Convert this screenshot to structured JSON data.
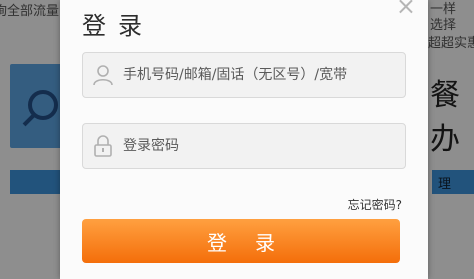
{
  "background": {
    "top_left_fragment": "询全部流量",
    "right_line1": "一样",
    "right_line2": "选择",
    "right_line3": "超超实惠",
    "big_text": "餐办",
    "bar_right_text": "理"
  },
  "modal": {
    "title": "登录",
    "close_label": "×",
    "account": {
      "placeholder": "手机号码/邮箱/固话（无区号）/宽带",
      "value": ""
    },
    "password": {
      "placeholder": "登录密码",
      "value": ""
    },
    "forgot_label": "忘记密码?",
    "login_button_label": "登录"
  },
  "colors": {
    "accent": "#f47a1a",
    "overlay": "rgba(0,0,0,0.42)"
  }
}
